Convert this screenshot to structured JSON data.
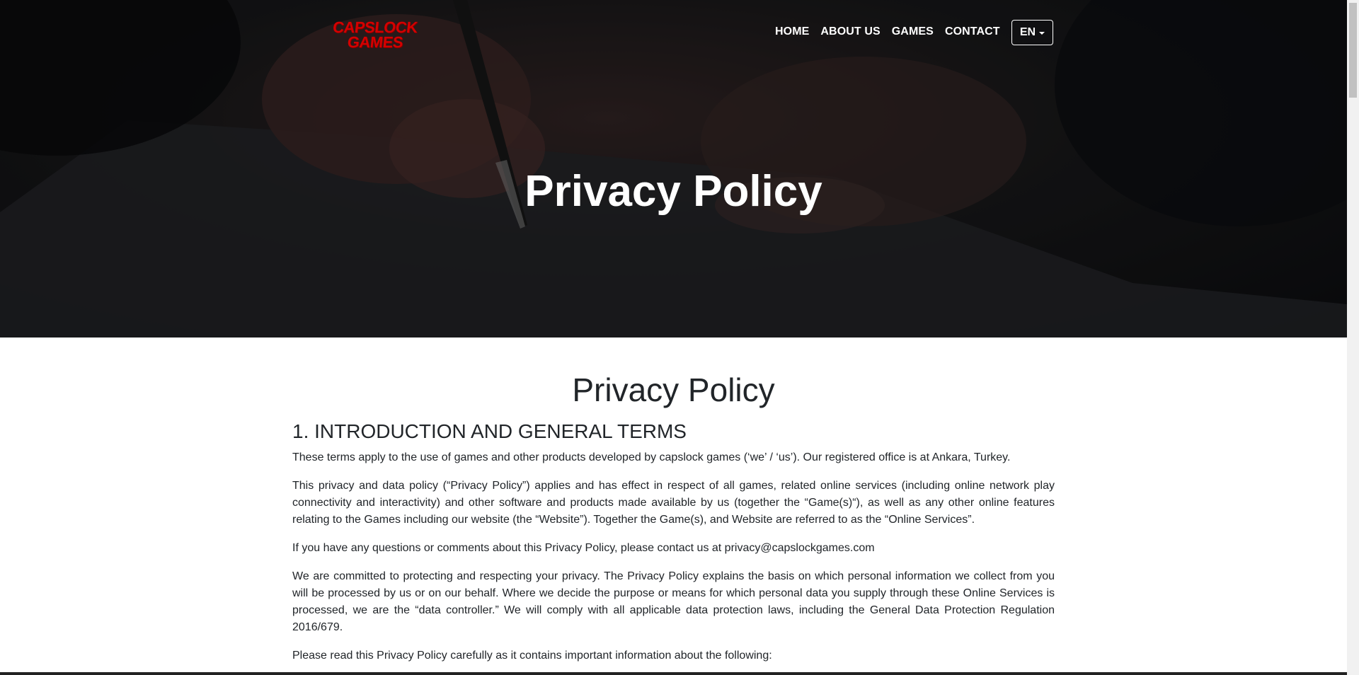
{
  "brand": {
    "logo_line1": "CAPSLOCK",
    "logo_line2": "GAMES"
  },
  "nav": {
    "items": [
      "HOME",
      "ABOUT US",
      "GAMES",
      "CONTACT"
    ],
    "language": "EN"
  },
  "hero": {
    "title": "Privacy Policy"
  },
  "content": {
    "title": "Privacy Policy",
    "section_1_heading": "1. INTRODUCTION AND GENERAL TERMS",
    "paragraphs": [
      "These terms apply to the use of games and other products developed by capslock games (‘we’ / ‘us’). Our registered office is at Ankara, Turkey.",
      "This privacy and data policy (“Privacy Policy”) applies and has effect in respect of all games, related online services (including online network play connectivity and interactivity) and other software and products made available by us (together the “Game(s)“), as well as any other online features relating to the Games including our website (the “Website”). Together the Game(s), and Website are referred to as the “Online Services”.",
      "If you have any questions or comments about this Privacy Policy, please contact us at privacy@capslockgames.com",
      "We are committed to protecting and respecting your privacy. The Privacy Policy explains the basis on which personal information we collect from you will be processed by us or on our behalf. Where we decide the purpose or means for which personal data you supply through these Online Services is processed, we are the “data controller.” We will comply with all applicable data protection laws, including the General Data Protection Regulation 2016/679.",
      "Please read this Privacy Policy carefully as it contains important information about the following:"
    ]
  },
  "colors": {
    "brand_red": "#d40000",
    "hero_overlay": "#141518",
    "text": "#212529"
  }
}
